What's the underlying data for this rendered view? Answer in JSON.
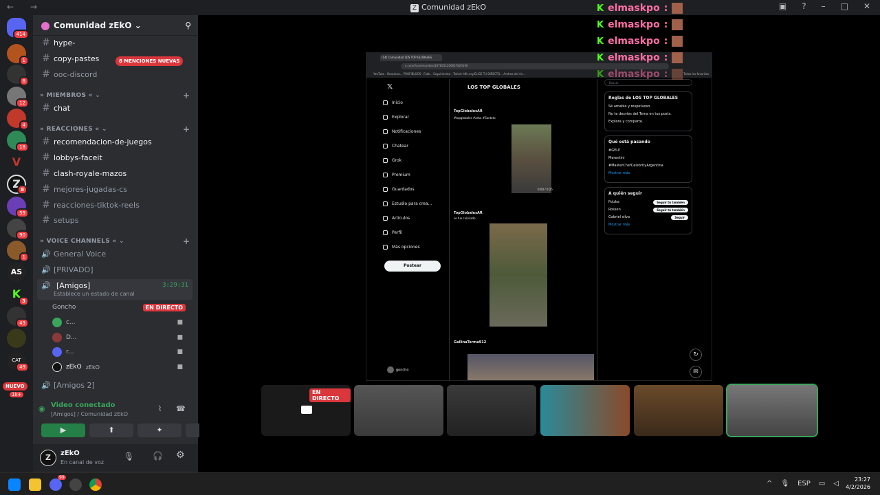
{
  "window": {
    "title": "Comunidad zEkO",
    "controls": [
      "–",
      "□",
      "✕"
    ]
  },
  "servers": {
    "badges": [
      "414",
      "1",
      "8",
      "12",
      "4",
      "18",
      "8",
      "59",
      "90",
      "1",
      "3",
      "43",
      "49",
      "1k+"
    ],
    "new_label": "NUEVO",
    "cat_label": "CAT"
  },
  "guild": {
    "name": "Comunidad zEkO",
    "mentions_pill": "8 MENCIONES NUEVAS",
    "channels_top": [
      {
        "label": "hype-"
      },
      {
        "label": "copy-pastes"
      },
      {
        "label": "ooc-discord"
      }
    ],
    "cat_miembros": "MIEMBROS",
    "ch_chat": "chat",
    "cat_reacciones": "REACCIONES",
    "reacciones": [
      {
        "label": "recomendacion-de-juegos"
      },
      {
        "label": "lobbys-faceit"
      },
      {
        "label": "clash-royale-mazos"
      },
      {
        "label": "mejores-jugadas-cs"
      },
      {
        "label": "reacciones-tiktok-reels"
      },
      {
        "label": "setups"
      }
    ],
    "cat_voice": "VOICE CHANNELS",
    "voice": {
      "general": "General Voice",
      "privado": "[PRIVADO]",
      "amigos": "[Amigos]",
      "amigos_time": "3:29:31",
      "amigos_status": "Establece un estado de canal",
      "amigos2": "[Amigos 2]"
    },
    "members": [
      {
        "name": "Goncho",
        "live": "EN DIRECTO"
      },
      {
        "name": "c..."
      },
      {
        "name": "D..."
      },
      {
        "name": "r..."
      },
      {
        "name": "zEkO",
        "tag": "zEkO"
      }
    ]
  },
  "vc_panel": {
    "title": "Video conectado",
    "sub": "[Amigos] / Comunidad zEkO"
  },
  "user": {
    "name": "zEkO",
    "status": "En canal de voz"
  },
  "browser": {
    "tab": "(14) Comunidad LOS TOP GLOBALES",
    "url": "x.com/i/communities/1678011206657824190",
    "bookmarks": "YouTube - Broadcas...   PROFIBLOGS - Fotb...   Seguimiento - Twitch   hffn.org   ELIGE TU DIRECTO...   Andrea del rie...",
    "bookmarks_right": "Todos los favoritos"
  },
  "x": {
    "nav": [
      "Inicio",
      "Explorar",
      "Notificaciones",
      "Chatear",
      "Grok",
      "Premium",
      "Guardados",
      "Estudio para crea...",
      "Artículos",
      "Perfil",
      "Más opciones"
    ],
    "post_btn": "Postear",
    "feed_title": "LOS TOP GLOBALES",
    "post1_author": "TopGlobalesAR",
    "post1_text": "#topglobales #zeko #Santoto",
    "post1_time": "0:04 / 0:25",
    "post2_author": "TopGlobalesAR",
    "post2_text": "se fue cubicado",
    "post3_author": "GallinaTerma912",
    "me": "goncho",
    "rules_title": "Reglas de LOS TOP GLOBALES",
    "rules": [
      "Sé amable y respetuoso.",
      "No te desvíes del Tema en tus posts.",
      "Explora y comparte."
    ],
    "trends_title": "Qué está pasando",
    "trends": [
      "#GELP",
      "Merentini",
      "#MasterChefCelebrityArgentina"
    ],
    "show_more": "Mostrar más",
    "follow_title": "A quién seguir",
    "follow": [
      {
        "name": "Polzka",
        "btn": "Seguir tú también"
      },
      {
        "name": "Rossen",
        "btn": "Seguir tú también"
      },
      {
        "name": "Gabriel silva",
        "btn": "Seguir"
      }
    ],
    "search": "Buscar"
  },
  "kick_overlay": {
    "user": "elmaskpo",
    "sep": ":"
  },
  "thumbs_live": "EN DIRECTO",
  "taskbar": {
    "lang": "ESP",
    "time": "23:27",
    "date": "4/2/2026",
    "discord_badge": "99"
  }
}
